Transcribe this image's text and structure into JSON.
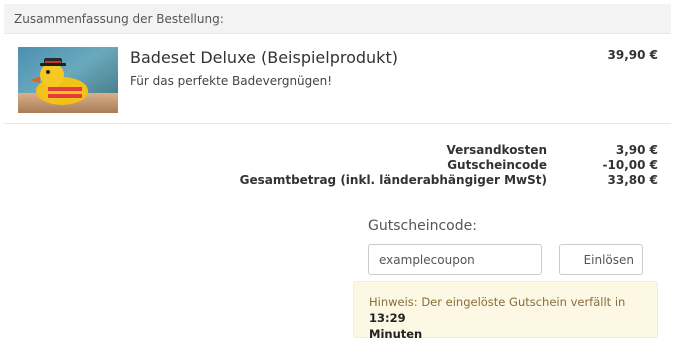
{
  "summary": {
    "header": "Zusammenfassung der Bestellung:"
  },
  "product": {
    "name": "Badeset Deluxe (Beispielprodukt)",
    "description": "Für das perfekte Badevergnügen!",
    "price": "39,90 €",
    "image_icon": "rubber-duck-image"
  },
  "totals": {
    "rows": [
      {
        "label": "Versandkosten",
        "value": "3,90 €"
      },
      {
        "label": "Gutscheincode",
        "value": "-10,00 €"
      },
      {
        "label": "Gesamtbetrag (inkl. länderabhängiger MwSt)",
        "value": "33,80 €"
      }
    ]
  },
  "coupon": {
    "title": "Gutscheincode:",
    "input_value": "examplecoupon",
    "button_label": "Einlösen"
  },
  "notice": {
    "text": "Hinweis: Der eingelöste Gutschein verfällt in",
    "time": "13:29",
    "unit": "Minuten"
  },
  "colors": {
    "header_bg": "#f3f3f3",
    "notice_bg": "#fcf8e3",
    "notice_border": "#faebcc",
    "notice_text": "#8a6d3b"
  }
}
